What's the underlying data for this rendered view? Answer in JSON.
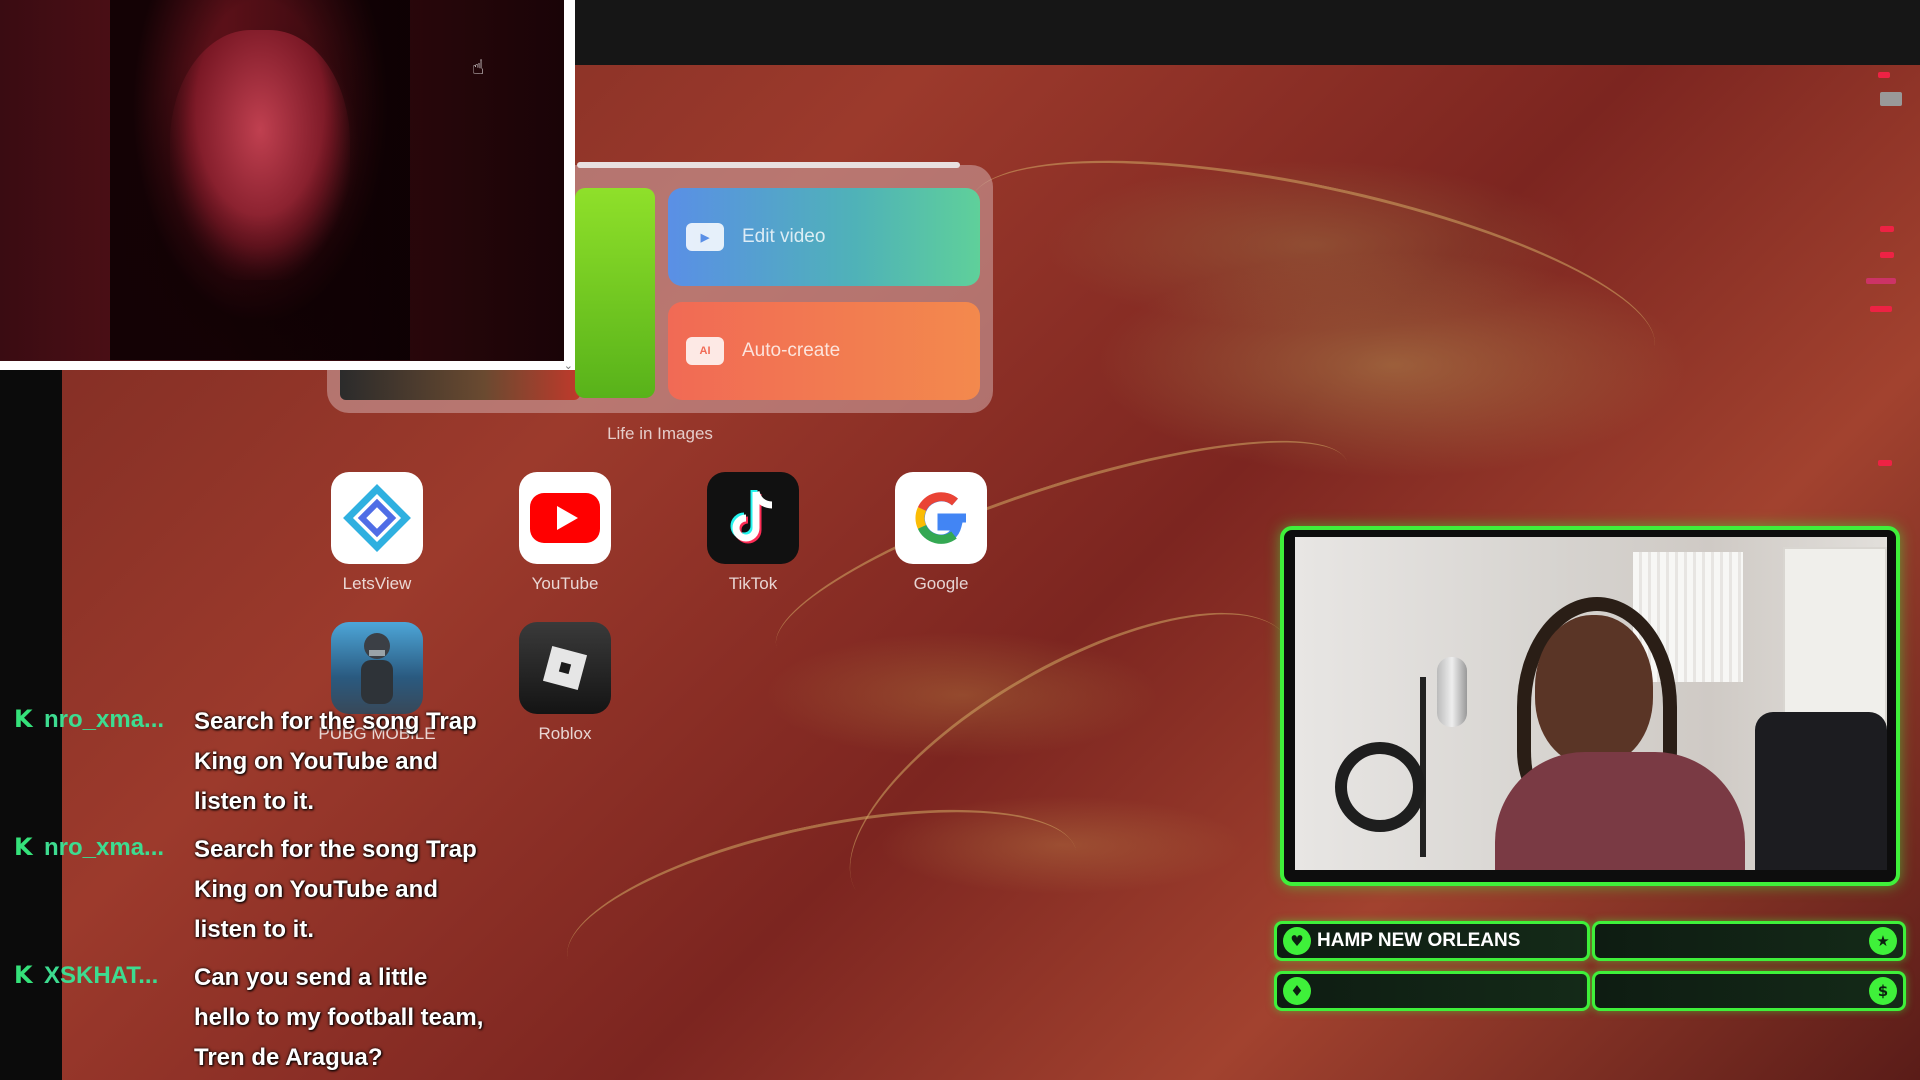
{
  "widget": {
    "edit_label": "Edit video",
    "auto_label": "Auto-create",
    "auto_badge": "AI",
    "caption": "Life in Images"
  },
  "apps": [
    {
      "label": "LetsView",
      "icon": "letsview-icon"
    },
    {
      "label": "YouTube",
      "icon": "youtube-icon"
    },
    {
      "label": "TikTok",
      "icon": "tiktok-icon"
    },
    {
      "label": "Google",
      "icon": "google-icon"
    },
    {
      "label": "PUBG MOBILE",
      "icon": "pubg-icon"
    },
    {
      "label": "Roblox",
      "icon": "roblox-icon"
    }
  ],
  "chat": [
    {
      "user": "nro_xma...",
      "text": "Search for the song Trap King on YouTube and listen to it."
    },
    {
      "user": "nro_xma...",
      "text": "Search for the song Trap King on YouTube and listen to it."
    },
    {
      "user": "XSKHAT...",
      "text": "Can you send a little hello to my football team, Tren de Aragua?"
    }
  ],
  "panels": {
    "top_left_text": "HAMP NEW ORLEANS",
    "top_left_icon": "heart-icon",
    "top_right_icon": "star-icon",
    "bottom_left_icon": "drop-icon",
    "bottom_right_icon": "dollar-icon"
  },
  "colors": {
    "accent_green": "#3ff03a",
    "chat_username": "#3ddc90",
    "wallpaper": "#8e3328"
  }
}
